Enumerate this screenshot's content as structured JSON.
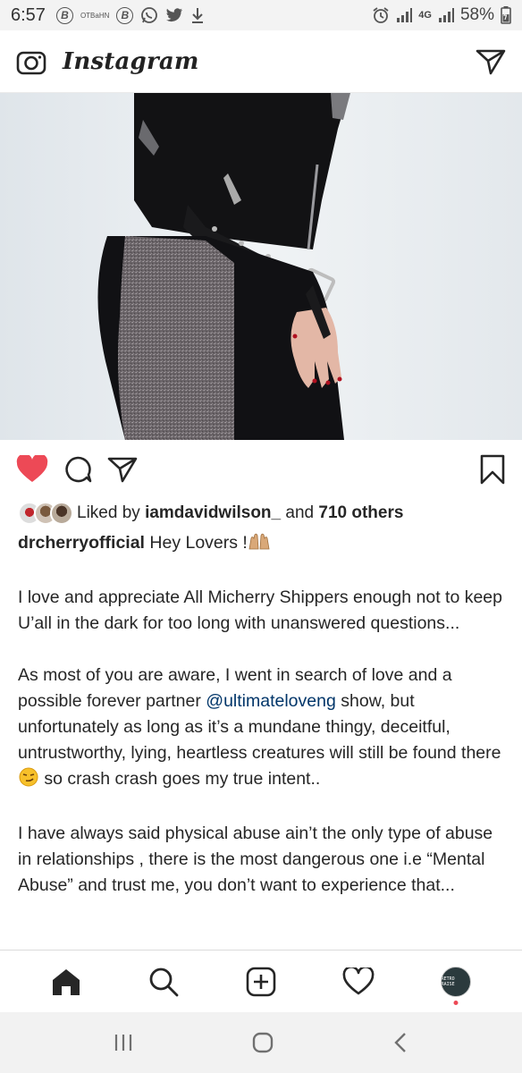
{
  "status_bar": {
    "time": "6:57",
    "icon_letter": "B",
    "small_label": "OTBaHN",
    "network": "4G",
    "battery": "58%"
  },
  "header": {
    "app_name": "Instagram"
  },
  "post": {
    "liked": true,
    "likes": {
      "prefix": "Liked by",
      "user": "iamdavidwilson_",
      "connector": "and",
      "others": "710 others"
    },
    "caption": {
      "username": "drcherryofficial",
      "first_line": "Hey Lovers !",
      "p1": "I love and appreciate All Micherry Shippers enough not to keep U’all in the dark for too long with unanswered questions...",
      "p2_before": "As most of you are aware, I went in search of love and a possible forever partner",
      "p2_mention": "@ultimateloveng",
      "p2_mid": "show, but unfortunately as long as it’s a mundane thingy, deceitful, untrustworthy, lying, heartless creatures will still be found there",
      "p2_after": "so crash crash goes my true intent..",
      "p3": "I have always said physical abuse ain’t the only type of abuse in relationships , there is the most dangerous one i.e “Mental Abuse” and trust me, you don’t want to experience that..."
    }
  },
  "bottom_nav": {
    "profile_text": "RETRO RAISE"
  },
  "colors": {
    "like_red": "#ed4956",
    "mention_blue": "#003569"
  }
}
